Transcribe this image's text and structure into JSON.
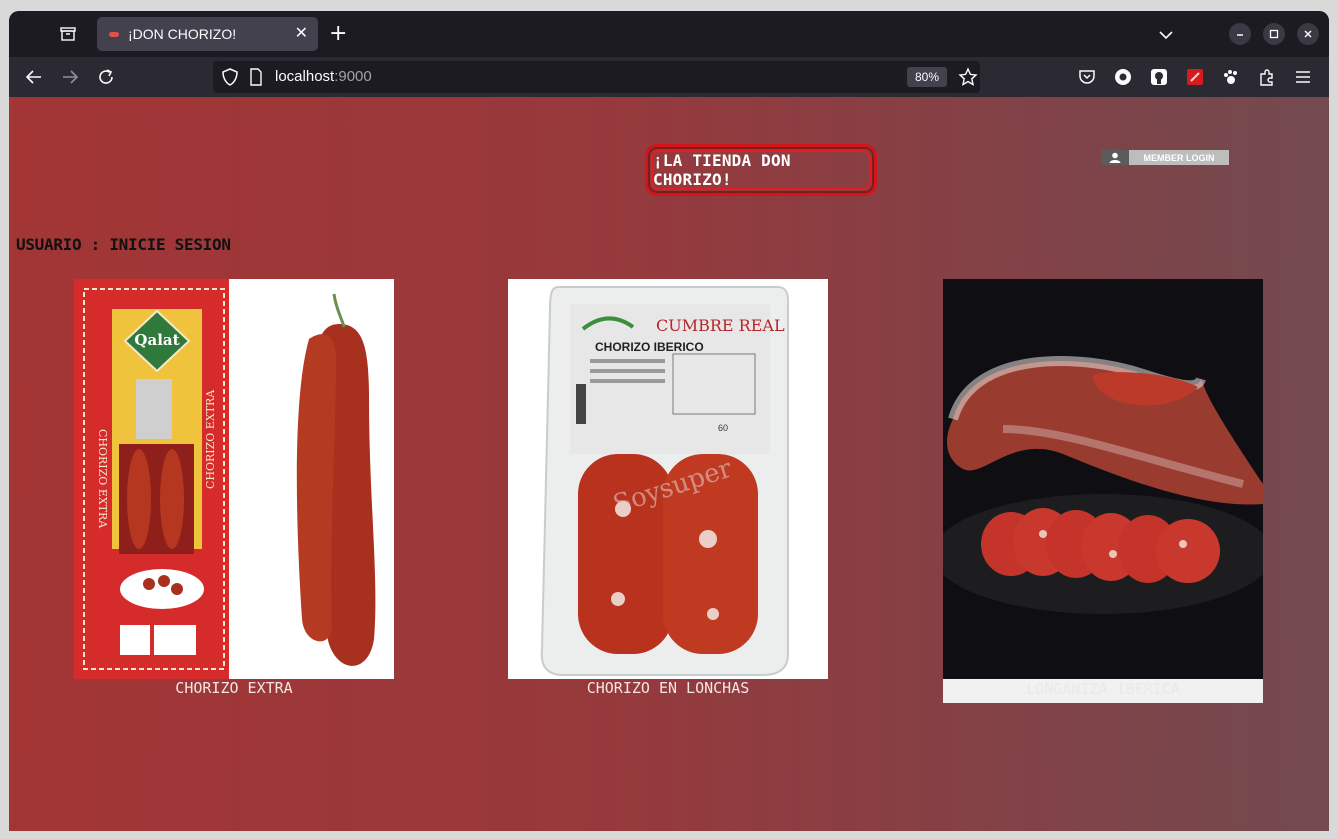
{
  "browser": {
    "tab_title": "¡DON CHORIZO!",
    "url_host": "localhost",
    "url_port": ":9000",
    "zoom": "80%"
  },
  "site": {
    "title": "¡LA TIENDA DON CHORIZO!",
    "member_login": "MEMBER LOGIN",
    "user_status": "USUARIO : INICIE SESION"
  },
  "products": [
    {
      "name": "CHORIZO EXTRA",
      "package_brand": "Qalat",
      "package_text": "CHORIZO EXTRA"
    },
    {
      "name": "CHORIZO EN LONCHAS",
      "package_brand": "CUMBRE REAL",
      "package_text": "CHORIZO IBERICO",
      "weight": "60"
    },
    {
      "name": "LONGANIZA IBERICA"
    }
  ],
  "colors": {
    "page_gradient_start": "#a33535",
    "page_gradient_end": "#734a50",
    "title_border": "#d0161a",
    "browser_chrome": "#2b2a33"
  }
}
